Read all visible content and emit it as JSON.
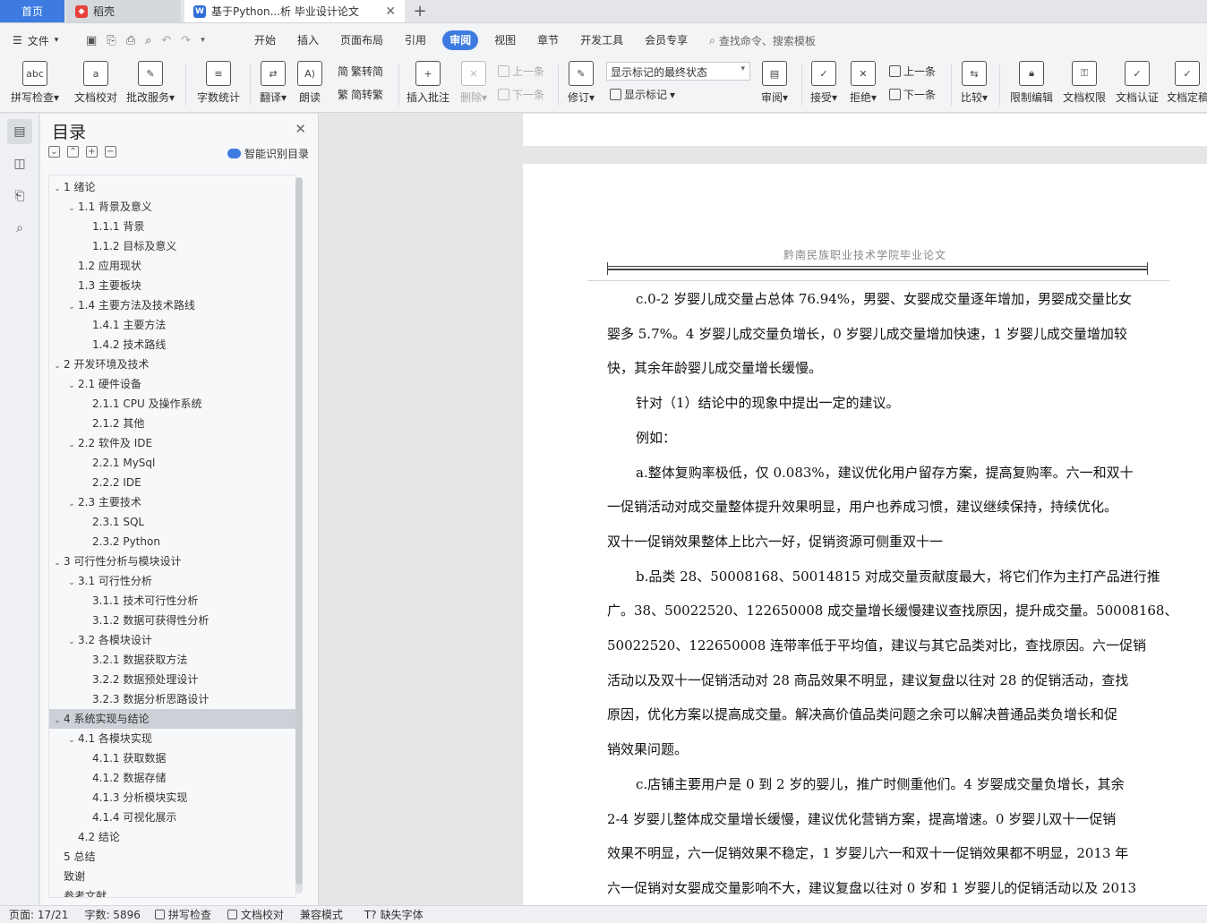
{
  "tabs": {
    "home": "首页",
    "daoke": "稻壳",
    "doc": "基于Python...析 毕业设计论文"
  },
  "menu": {
    "file": "文件",
    "tabs": [
      "开始",
      "插入",
      "页面布局",
      "引用",
      "审阅",
      "视图",
      "章节",
      "开发工具",
      "会员专享"
    ],
    "active_tab": "审阅",
    "search": "查找命令、搜索模板"
  },
  "ribbon": {
    "spellcheck": "拼写检查",
    "doc_check": "文档校对",
    "batch": "批改服务",
    "word_count": "字数统计",
    "translate": "翻译",
    "read": "朗读",
    "trad": "繁转简",
    "simp": "简转繁",
    "insert_comment": "插入批注",
    "delete": "删除",
    "prev": "上一条",
    "next": "下一条",
    "track": "修订",
    "markup_state": "显示标记的最终状态",
    "show_markup": "显示标记",
    "review": "审阅",
    "accept": "接受",
    "reject": "拒绝",
    "prev2": "上一条",
    "next2": "下一条",
    "compare": "比较",
    "restrict": "限制编辑",
    "perm": "文档权限",
    "cert": "文档认证",
    "final": "文档定稿"
  },
  "toc": {
    "title": "目录",
    "smart": "智能识别目录",
    "items": [
      {
        "text": "1  绪论",
        "level": 0,
        "caret": true
      },
      {
        "text": "1.1  背景及意义",
        "level": 1,
        "caret": true
      },
      {
        "text": "1.1.1  背景",
        "level": 2,
        "caret": false
      },
      {
        "text": "1.1.2  目标及意义",
        "level": 2,
        "caret": false
      },
      {
        "text": "1.2  应用现状",
        "level": 1,
        "caret": false
      },
      {
        "text": "1.3  主要板块",
        "level": 1,
        "caret": false
      },
      {
        "text": "1.4  主要方法及技术路线",
        "level": 1,
        "caret": true
      },
      {
        "text": "1.4.1  主要方法",
        "level": 2,
        "caret": false
      },
      {
        "text": "1.4.2  技术路线",
        "level": 2,
        "caret": false
      },
      {
        "text": "2 开发环境及技术",
        "level": 0,
        "caret": true
      },
      {
        "text": "2.1 硬件设备",
        "level": 1,
        "caret": true
      },
      {
        "text": "2.1.1 CPU 及操作系统",
        "level": 2,
        "caret": false
      },
      {
        "text": "2.1.2  其他",
        "level": 2,
        "caret": false
      },
      {
        "text": "2.2 软件及 IDE",
        "level": 1,
        "caret": true
      },
      {
        "text": "2.2.1 MySql",
        "level": 2,
        "caret": false
      },
      {
        "text": "2.2.2 IDE",
        "level": 2,
        "caret": false
      },
      {
        "text": "2.3 主要技术",
        "level": 1,
        "caret": true
      },
      {
        "text": "2.3.1 SQL",
        "level": 2,
        "caret": false
      },
      {
        "text": "2.3.2 Python",
        "level": 2,
        "caret": false
      },
      {
        "text": "3  可行性分析与模块设计",
        "level": 0,
        "caret": true
      },
      {
        "text": "3.1  可行性分析",
        "level": 1,
        "caret": true
      },
      {
        "text": "3.1.1  技术可行性分析",
        "level": 2,
        "caret": false
      },
      {
        "text": "3.1.2  数据可获得性分析",
        "level": 2,
        "caret": false
      },
      {
        "text": "3.2  各模块设计",
        "level": 1,
        "caret": true
      },
      {
        "text": "3.2.1  数据获取方法",
        "level": 2,
        "caret": false
      },
      {
        "text": "3.2.2  数据预处理设计",
        "level": 2,
        "caret": false
      },
      {
        "text": "3.2.3  数据分析思路设计",
        "level": 2,
        "caret": false
      },
      {
        "text": "4  系统实现与结论",
        "level": 0,
        "caret": true,
        "selected": true
      },
      {
        "text": "4.1  各模块实现",
        "level": 1,
        "caret": true
      },
      {
        "text": "4.1.1  获取数据",
        "level": 2,
        "caret": false
      },
      {
        "text": "4.1.2  数据存储",
        "level": 2,
        "caret": false
      },
      {
        "text": "4.1.3  分析模块实现",
        "level": 2,
        "caret": false
      },
      {
        "text": "4.1.4  可视化展示",
        "level": 2,
        "caret": false
      },
      {
        "text": "4.2  结论",
        "level": 1,
        "caret": false
      },
      {
        "text": "5 总结",
        "level": 0,
        "caret": false
      },
      {
        "text": "致谢",
        "level": 0,
        "caret": false
      },
      {
        "text": "参考文献",
        "level": 0,
        "caret": false
      }
    ]
  },
  "document": {
    "header": "黔南民族职业技术学院毕业论文",
    "lines": [
      {
        "text": "c.0-2 岁婴儿成交量占总体 76.94%，男婴、女婴成交量逐年增加，男婴成交量比女",
        "indent": true
      },
      {
        "text": "婴多 5.7%。4 岁婴儿成交量负增长，0 岁婴儿成交量增加快速，1 岁婴儿成交量增加较",
        "indent": false
      },
      {
        "text": "快，其余年龄婴儿成交量增长缓慢。",
        "indent": false
      },
      {
        "text": "针对（1）结论中的现象中提出一定的建议。",
        "indent": true
      },
      {
        "text": "例如：",
        "indent": true
      },
      {
        "text": "a.整体复购率极低，仅 0.083%，建议优化用户留存方案，提高复购率。六一和双十",
        "indent": true
      },
      {
        "text": "一促销活动对成交量整体提升效果明显，用户也养成习惯，建议继续保持，持续优化。",
        "indent": false
      },
      {
        "text": "双十一促销效果整体上比六一好，促销资源可侧重双十一",
        "indent": false
      },
      {
        "text": "b.品类 28、50008168、50014815 对成交量贡献度最大，将它们作为主打产品进行推",
        "indent": true
      },
      {
        "text": "广。38、50022520、122650008 成交量增长缓慢建议查找原因，提升成交量。50008168、",
        "indent": false
      },
      {
        "text": "50022520、122650008 连带率低于平均值，建议与其它品类对比，查找原因。六一促销",
        "indent": false
      },
      {
        "text": "活动以及双十一促销活动对 28 商品效果不明显，建议复盘以往对 28 的促销活动，查找",
        "indent": false
      },
      {
        "text": "原因，优化方案以提高成交量。解决高价值品类问题之余可以解决普通品类负增长和促",
        "indent": false
      },
      {
        "text": "销效果问题。",
        "indent": false
      },
      {
        "text": "c.店铺主要用户是 0 到 2 岁的婴儿，推广时侧重他们。4 岁婴成交量负增长，其余",
        "indent": true
      },
      {
        "text": "2-4 岁婴儿整体成交量增长缓慢，建议优化营销方案，提高增速。0 岁婴儿双十一促销",
        "indent": false
      },
      {
        "text": "效果不明显，六一促销效果不稳定，1 岁婴儿六一和双十一促销效果都不明显，2013 年",
        "indent": false
      },
      {
        "text": "六一促销对女婴成交量影响不大，建议复盘以往对 0 岁和 1 岁婴儿的促销活动以及 2013",
        "indent": false
      }
    ]
  },
  "status": {
    "page": "页面: 17/21",
    "words": "字数: 5896",
    "spell": "拼写检查",
    "proof": "文档校对",
    "compat": "兼容模式",
    "missing_font": "缺失字体"
  }
}
